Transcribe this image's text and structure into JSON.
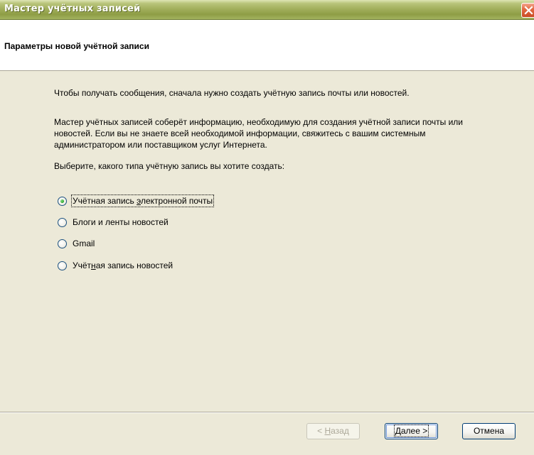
{
  "window": {
    "title": "Мастер учётных записей"
  },
  "header": {
    "heading": "Параметры новой учётной записи"
  },
  "body": {
    "paragraph1": "Чтобы получать сообщения, сначала нужно создать учётную запись почты или новостей.",
    "paragraph2": "Мастер учётных записей соберёт информацию, необходимую для создания учётной записи почты или новостей. Если вы не знаете всей необходимой информации, свяжитесь с вашим системным администратором или поставщиком услуг Интернета.",
    "prompt": "Выберите, какого типа учётную запись вы хотите создать:"
  },
  "options": [
    {
      "label_pre": "Учётная запись ",
      "label_key": "э",
      "label_post": "лектронной почты",
      "selected": true
    },
    {
      "label_pre": "Блоги и ленты новостей",
      "label_key": "",
      "label_post": "",
      "selected": false
    },
    {
      "label_pre": "Gmail",
      "label_key": "",
      "label_post": "",
      "selected": false
    },
    {
      "label_pre": "Учёт",
      "label_key": "н",
      "label_post": "ая запись новостей",
      "selected": false
    }
  ],
  "buttons": {
    "back_pre": "< ",
    "back_key": "Н",
    "back_post": "азад",
    "next_key": "Д",
    "next_post": "алее >",
    "cancel": "Отмена"
  },
  "colors": {
    "titlebar": "#a3b05e",
    "dialog_bg": "#ece9d8",
    "close_button": "#e36a43",
    "radio_dot": "#21a121"
  }
}
